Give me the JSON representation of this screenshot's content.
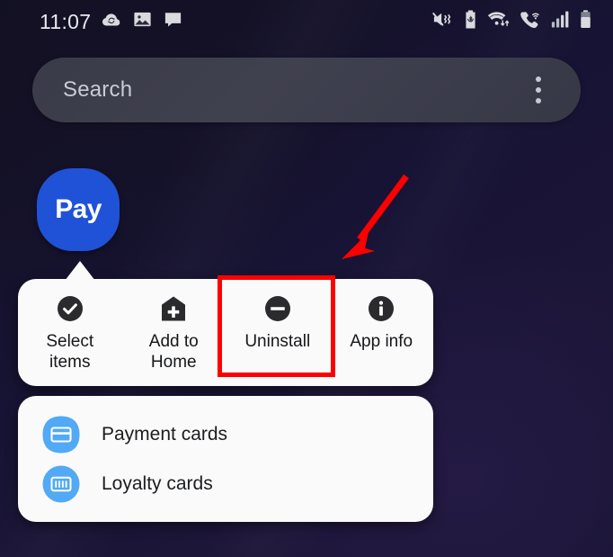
{
  "status_bar": {
    "time": "11:07",
    "left_icons": [
      {
        "name": "cloud-sync-icon",
        "label": "Cloud sync"
      },
      {
        "name": "photo-icon",
        "label": "Gallery"
      },
      {
        "name": "message-icon",
        "label": "Messages"
      }
    ],
    "right_icons": [
      {
        "name": "mute-vibrate-icon",
        "label": "Sound muted / vibrate"
      },
      {
        "name": "battery-saver-icon",
        "label": "Battery saver"
      },
      {
        "name": "wifi-data-icon",
        "label": "Wi-Fi"
      },
      {
        "name": "wifi-calling-icon",
        "label": "Wi-Fi calling"
      },
      {
        "name": "signal-bars-icon",
        "label": "Mobile signal"
      },
      {
        "name": "battery-icon",
        "label": "Battery"
      }
    ]
  },
  "search": {
    "placeholder": "Search",
    "value": "",
    "overflow_label": "More options"
  },
  "app": {
    "name": "Pay",
    "icon_label": "Pay",
    "icon_color": "#2052d8"
  },
  "popup_menu": {
    "items": [
      {
        "label": "Select items",
        "icon": "check-circle-icon",
        "highlighted": false
      },
      {
        "label": "Add to Home",
        "icon": "home-plus-icon",
        "highlighted": false
      },
      {
        "label": "Uninstall",
        "icon": "minus-circle-icon",
        "highlighted": true
      },
      {
        "label": "App info",
        "icon": "info-circle-icon",
        "highlighted": false
      }
    ]
  },
  "shortcuts": {
    "items": [
      {
        "label": "Payment cards",
        "icon": "payment-card-icon"
      },
      {
        "label": "Loyalty cards",
        "icon": "loyalty-barcode-icon"
      }
    ]
  },
  "annotation": {
    "highlight_target": "Uninstall",
    "highlight_color": "#ff0000",
    "arrow_color": "#ff0000",
    "arrow_direction": "down-left"
  },
  "colors": {
    "background": "#171334",
    "card": "#fafafa",
    "search_bar": "#3d3e4c",
    "accent_blue": "#2052d8",
    "shortcut_icon_blue": "#52a9f5",
    "menu_icon_dark": "#2b2b2f"
  }
}
